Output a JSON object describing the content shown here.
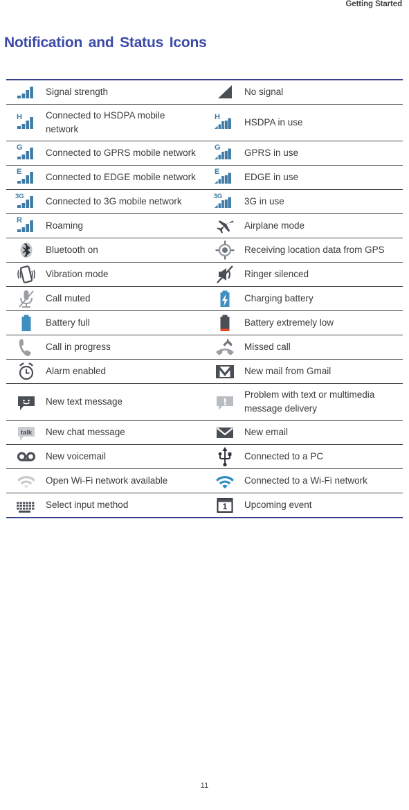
{
  "header": {
    "running_title": "Getting Started"
  },
  "section": {
    "title": "Notification and Status Icons"
  },
  "footer": {
    "page_number": "11"
  },
  "colors": {
    "title_blue": "#3b4aa6",
    "table_rule_blue": "#373f8c",
    "row_divider": "#4a4a4a",
    "signal_blue": "#3e7ba6",
    "icon_gray": "#4a4e55",
    "icon_light_gray": "#b9bcc0",
    "battery_low_red": "#e8491f",
    "wifi_blue": "#2d8ec4",
    "text_gray": "#3a3a3a"
  },
  "table": {
    "rows": [
      {
        "left": {
          "icon": "signal-bars-icon",
          "label": "Signal strength"
        },
        "right": {
          "icon": "no-signal-icon",
          "label": "No signal"
        }
      },
      {
        "left": {
          "icon": "hsdpa-connected-icon",
          "label": "Connected to HSDPA mobile network"
        },
        "right": {
          "icon": "hsdpa-in-use-icon",
          "label": "HSDPA in use"
        }
      },
      {
        "left": {
          "icon": "gprs-connected-icon",
          "label": "Connected to GPRS mobile network"
        },
        "right": {
          "icon": "gprs-in-use-icon",
          "label": "GPRS in use"
        }
      },
      {
        "left": {
          "icon": "edge-connected-icon",
          "label": "Connected to EDGE mobile network"
        },
        "right": {
          "icon": "edge-in-use-icon",
          "label": "EDGE in use"
        }
      },
      {
        "left": {
          "icon": "threeg-connected-icon",
          "label": "Connected to 3G mobile network"
        },
        "right": {
          "icon": "threeg-in-use-icon",
          "label": "3G in use"
        }
      },
      {
        "left": {
          "icon": "roaming-icon",
          "label": "Roaming"
        },
        "right": {
          "icon": "airplane-mode-icon",
          "label": "Airplane mode"
        }
      },
      {
        "left": {
          "icon": "bluetooth-on-icon",
          "label": "Bluetooth on"
        },
        "right": {
          "icon": "gps-location-icon",
          "label": "Receiving location data from GPS"
        }
      },
      {
        "left": {
          "icon": "vibration-mode-icon",
          "label": "Vibration mode"
        },
        "right": {
          "icon": "ringer-silenced-icon",
          "label": "Ringer silenced"
        }
      },
      {
        "left": {
          "icon": "call-muted-icon",
          "label": "Call muted"
        },
        "right": {
          "icon": "charging-battery-icon",
          "label": "Charging battery"
        }
      },
      {
        "left": {
          "icon": "battery-full-icon",
          "label": "Battery full"
        },
        "right": {
          "icon": "battery-extremely-low-icon",
          "label": "Battery extremely low"
        }
      },
      {
        "left": {
          "icon": "call-in-progress-icon",
          "label": "Call in progress"
        },
        "right": {
          "icon": "missed-call-icon",
          "label": "Missed call"
        }
      },
      {
        "left": {
          "icon": "alarm-enabled-icon",
          "label": "Alarm enabled"
        },
        "right": {
          "icon": "gmail-new-mail-icon",
          "label": "New mail from Gmail"
        }
      },
      {
        "left": {
          "icon": "new-text-message-icon",
          "label": "New text message"
        },
        "right": {
          "icon": "message-delivery-problem-icon",
          "label": "Problem with text or multimedia message delivery"
        }
      },
      {
        "left": {
          "icon": "new-chat-message-icon",
          "label": "New chat message"
        },
        "right": {
          "icon": "new-email-icon",
          "label": "New email"
        }
      },
      {
        "left": {
          "icon": "new-voicemail-icon",
          "label": "New voicemail"
        },
        "right": {
          "icon": "usb-connected-icon",
          "label": "Connected to a PC"
        }
      },
      {
        "left": {
          "icon": "open-wifi-available-icon",
          "label": "Open Wi-Fi network available"
        },
        "right": {
          "icon": "wifi-connected-icon",
          "label": "Connected to a Wi-Fi network"
        }
      },
      {
        "left": {
          "icon": "select-input-method-icon",
          "label": "Select input method"
        },
        "right": {
          "icon": "upcoming-event-icon",
          "label": "Upcoming event"
        }
      }
    ]
  },
  "icon_text": {
    "hsdpa": "H",
    "gprs": "G",
    "edge": "E",
    "threeg": "3G",
    "roaming": "R",
    "talk": "talk",
    "event_day": "1"
  }
}
